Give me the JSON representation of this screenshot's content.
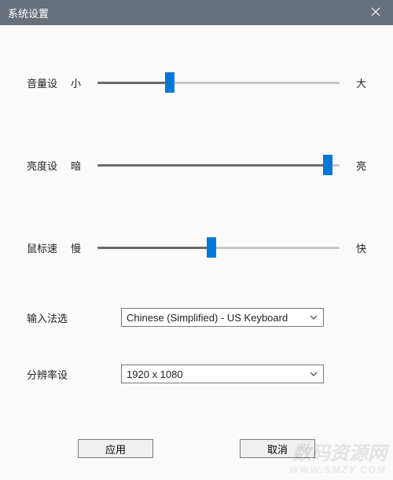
{
  "window": {
    "title": "系统设置"
  },
  "sliders": {
    "volume": {
      "label": "音量设",
      "min_label": "小",
      "max_label": "大",
      "value_percent": 30
    },
    "brightness": {
      "label": "亮度设",
      "min_label": "暗",
      "max_label": "亮",
      "value_percent": 95
    },
    "mouse": {
      "label": "鼠标速",
      "min_label": "慢",
      "max_label": "快",
      "value_percent": 47
    }
  },
  "selects": {
    "ime": {
      "label": "输入法选",
      "value": "Chinese (Simplified) - US Keyboard"
    },
    "resolution": {
      "label": "分辨率设",
      "value": "1920 x 1080"
    }
  },
  "buttons": {
    "apply": "应用",
    "cancel": "取消"
  },
  "colors": {
    "accent": "#0078d7",
    "track_left": "#6a6a6a",
    "track_right": "#c6c6c6"
  },
  "watermark": {
    "line1": "数码资源网",
    "line2": "WWW.SMZY.COM"
  }
}
